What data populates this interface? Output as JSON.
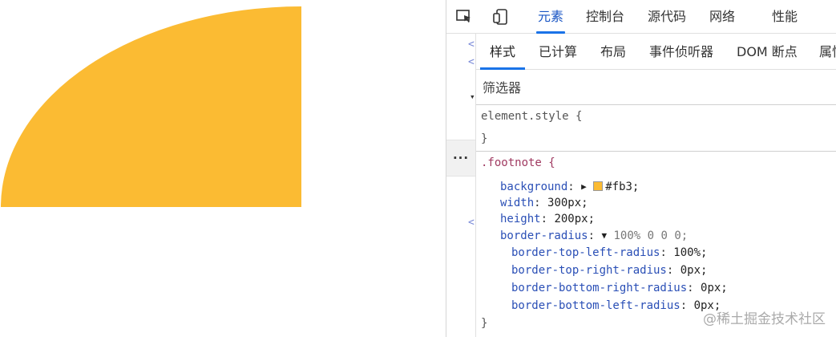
{
  "preview": {
    "shape_color": "#fbbb33"
  },
  "devtools": {
    "tabs": [
      {
        "label": "元素",
        "active": true
      },
      {
        "label": "控制台"
      },
      {
        "label": "源代码"
      },
      {
        "label": "网络"
      },
      {
        "label": "性能"
      }
    ],
    "styles_subtabs": [
      {
        "label": "样式",
        "active": true
      },
      {
        "label": "已计算"
      },
      {
        "label": "布局"
      },
      {
        "label": "事件侦听器"
      },
      {
        "label": "DOM 断点"
      },
      {
        "label": "属性"
      }
    ],
    "filter_placeholder": "筛选器",
    "dom_gutter_marks": [
      "<",
      "<",
      "▾",
      "<"
    ],
    "more_label": "···",
    "rules": {
      "element_style": {
        "selector": "element.style {",
        "close": "}"
      },
      "footnote": {
        "selector": ".footnote {",
        "background_prop": "background",
        "background_value": "#fb3;",
        "background_color": "#fbbb33",
        "width_prop": "width",
        "width_value": "300px;",
        "height_prop": "height",
        "height_value": "200px;",
        "radius_prop": "border-radius",
        "radius_value": "100% 0 0 0;",
        "tl_prop": "border-top-left-radius",
        "tl_value": "100%;",
        "tr_prop": "border-top-right-radius",
        "tr_value": "0px;",
        "br_prop": "border-bottom-right-radius",
        "br_value": "0px;",
        "bl_prop": "border-bottom-left-radius",
        "bl_value": "0px;",
        "close": "}"
      }
    }
  },
  "watermark": "@稀土掘金技术社区"
}
